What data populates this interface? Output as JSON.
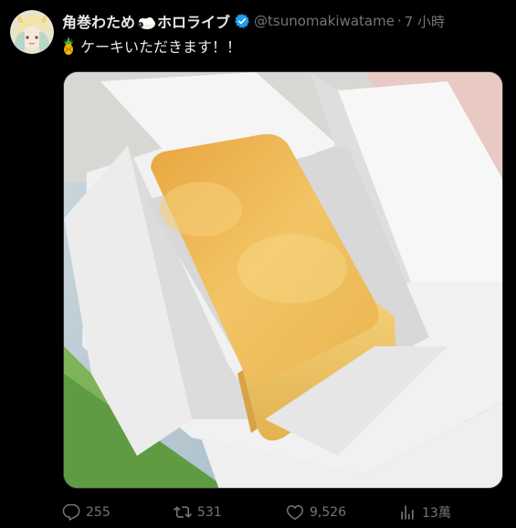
{
  "tweet": {
    "display_name_part1": "角巻わため",
    "name_emoji": "sheep-icon",
    "display_name_part2": "ホロライブ",
    "verified_icon": "verified-badge-icon",
    "handle": "@tsunomakiwatame",
    "separator": "·",
    "time": "7 小時",
    "text_emoji": "pineapple-icon",
    "text": "ケーキいただきます！！",
    "media_description": "photo-cake-in-paper-box"
  },
  "actions": {
    "reply_count": "255",
    "retweet_count": "531",
    "like_count": "9,526",
    "views_count": "13萬"
  },
  "colors": {
    "background": "#000000",
    "text": "#e7e9ea",
    "muted": "#71767b",
    "verified": "#1d9bf0"
  }
}
